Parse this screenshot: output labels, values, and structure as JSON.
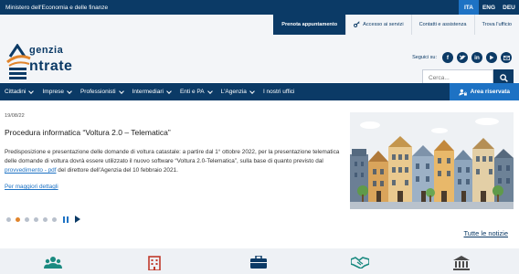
{
  "gov_bar": {
    "title": "Ministero dell'Economia e delle finanze",
    "languages": [
      "ITA",
      "ENG",
      "DEU"
    ],
    "active_language": "ITA"
  },
  "service_links": {
    "appointment": "Prenota appuntamento",
    "services_access": "Accesso ai servizi",
    "contacts": "Contatti e assistenza",
    "find_office": "Trova l'ufficio"
  },
  "logo": {
    "line1": "genzia",
    "line2": "ntrate"
  },
  "social": {
    "label": "Seguici su:",
    "icons": [
      "facebook-icon",
      "twitter-icon",
      "linkedin-icon",
      "youtube-icon",
      "mail-icon"
    ]
  },
  "search": {
    "placeholder": "Cerca..."
  },
  "nav": {
    "items": [
      "Cittadini",
      "Imprese",
      "Professionisti",
      "Intermediari",
      "Enti e PA",
      "L'Agenzia",
      "I nostri uffici"
    ],
    "reserved_area": "Area riservata"
  },
  "news": {
    "date": "19/08/22",
    "title": "Procedura informatica “Voltura 2.0 – Telematica”",
    "body_part1": "Predisposizione e presentazione delle domande di voltura catastale: a partire dal 1° ottobre 2022, per la presentazione telematica delle domande di voltura dovrà essere utilizzato il nuovo software “Voltura 2.0-Telematica”, sulla base di quanto previsto dal ",
    "body_link": "provvedimento - pdf",
    "body_part2": " del direttore dell'Agenzia del 10 febbraio 2021.",
    "more": "Per maggiori dettagli",
    "slide_count": 6,
    "active_slide": 2,
    "all_news": "Tutte le notizie"
  },
  "colors": {
    "primary": "#0b3a66",
    "accent": "#1d72c4",
    "orange": "#e0842c",
    "teal": "#1a8a80",
    "red": "#c0392b"
  }
}
